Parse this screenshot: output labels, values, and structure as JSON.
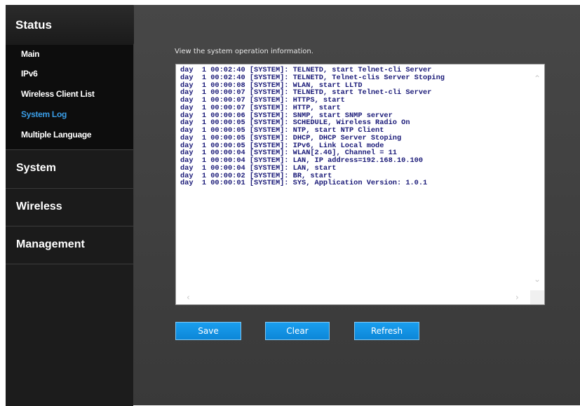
{
  "sidebar": {
    "status": {
      "title": "Status",
      "items": [
        {
          "label": "Main",
          "active": false
        },
        {
          "label": "IPv6",
          "active": false
        },
        {
          "label": "Wireless Client List",
          "active": false
        },
        {
          "label": "System Log",
          "active": true
        },
        {
          "label": "Multiple Language",
          "active": false
        }
      ]
    },
    "sections": [
      {
        "label": "System"
      },
      {
        "label": "Wireless"
      },
      {
        "label": "Management"
      }
    ]
  },
  "main": {
    "description": "View the system operation information.",
    "log_lines": [
      "day  1 00:02:40 [SYSTEM]: TELNETD, start Telnet-cli Server",
      "day  1 00:02:40 [SYSTEM]: TELNETD, Telnet-clis Server Stoping",
      "day  1 00:00:08 [SYSTEM]: WLAN, start LLTD",
      "day  1 00:00:07 [SYSTEM]: TELNETD, start Telnet-cli Server",
      "day  1 00:00:07 [SYSTEM]: HTTPS, start",
      "day  1 00:00:07 [SYSTEM]: HTTP, start",
      "day  1 00:00:06 [SYSTEM]: SNMP, start SNMP server",
      "day  1 00:00:05 [SYSTEM]: SCHEDULE, Wireless Radio On",
      "day  1 00:00:05 [SYSTEM]: NTP, start NTP Client",
      "day  1 00:00:05 [SYSTEM]: DHCP, DHCP Server Stoping",
      "day  1 00:00:05 [SYSTEM]: IPv6, Link Local mode",
      "day  1 00:00:04 [SYSTEM]: WLAN[2.4G], Channel = 11",
      "day  1 00:00:04 [SYSTEM]: LAN, IP address=192.168.10.100",
      "day  1 00:00:04 [SYSTEM]: LAN, start",
      "day  1 00:00:02 [SYSTEM]: BR, start",
      "day  1 00:00:01 [SYSTEM]: SYS, Application Version: 1.0.1"
    ],
    "buttons": {
      "save": "Save",
      "clear": "Clear",
      "refresh": "Refresh"
    }
  },
  "icons": {
    "scroll_up": "chevron-up-icon",
    "scroll_down": "chevron-down-icon",
    "scroll_left": "chevron-left-icon",
    "scroll_right": "chevron-right-icon"
  },
  "colors": {
    "active_item": "#3a9ee8",
    "button": "#1596e6",
    "log_text": "#1a1a78"
  }
}
